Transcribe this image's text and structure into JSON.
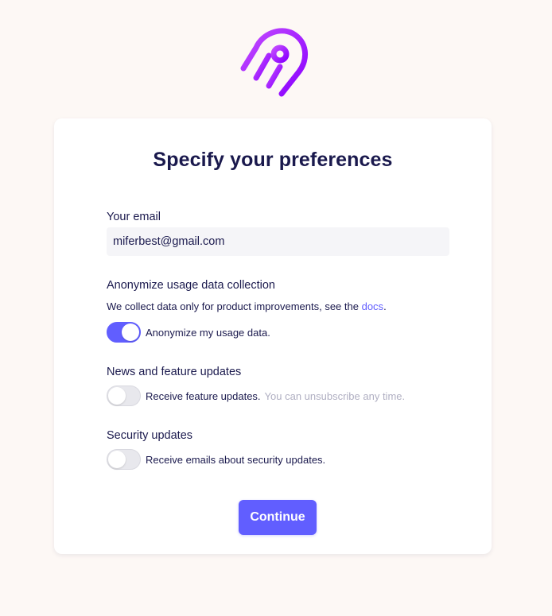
{
  "page": {
    "title": "Specify your preferences",
    "logo": "airbyte-logo"
  },
  "email": {
    "label": "Your email",
    "value": "miferbest@gmail.com"
  },
  "anonymize": {
    "label": "Anonymize usage data collection",
    "description": "We collect data only for product improvements, see the ",
    "link_text": "docs",
    "description_end": ".",
    "toggle_label": "Anonymize my usage data.",
    "enabled": true
  },
  "news": {
    "label": "News and feature updates",
    "toggle_label": "Receive feature updates.",
    "hint": "You can unsubscribe any time.",
    "enabled": false
  },
  "security": {
    "label": "Security updates",
    "toggle_label": "Receive emails about security updates.",
    "enabled": false
  },
  "actions": {
    "continue_label": "Continue"
  },
  "colors": {
    "accent": "#615eff",
    "text": "#1a194d",
    "background": "#fdf8f5",
    "logo": "#a000ff"
  }
}
